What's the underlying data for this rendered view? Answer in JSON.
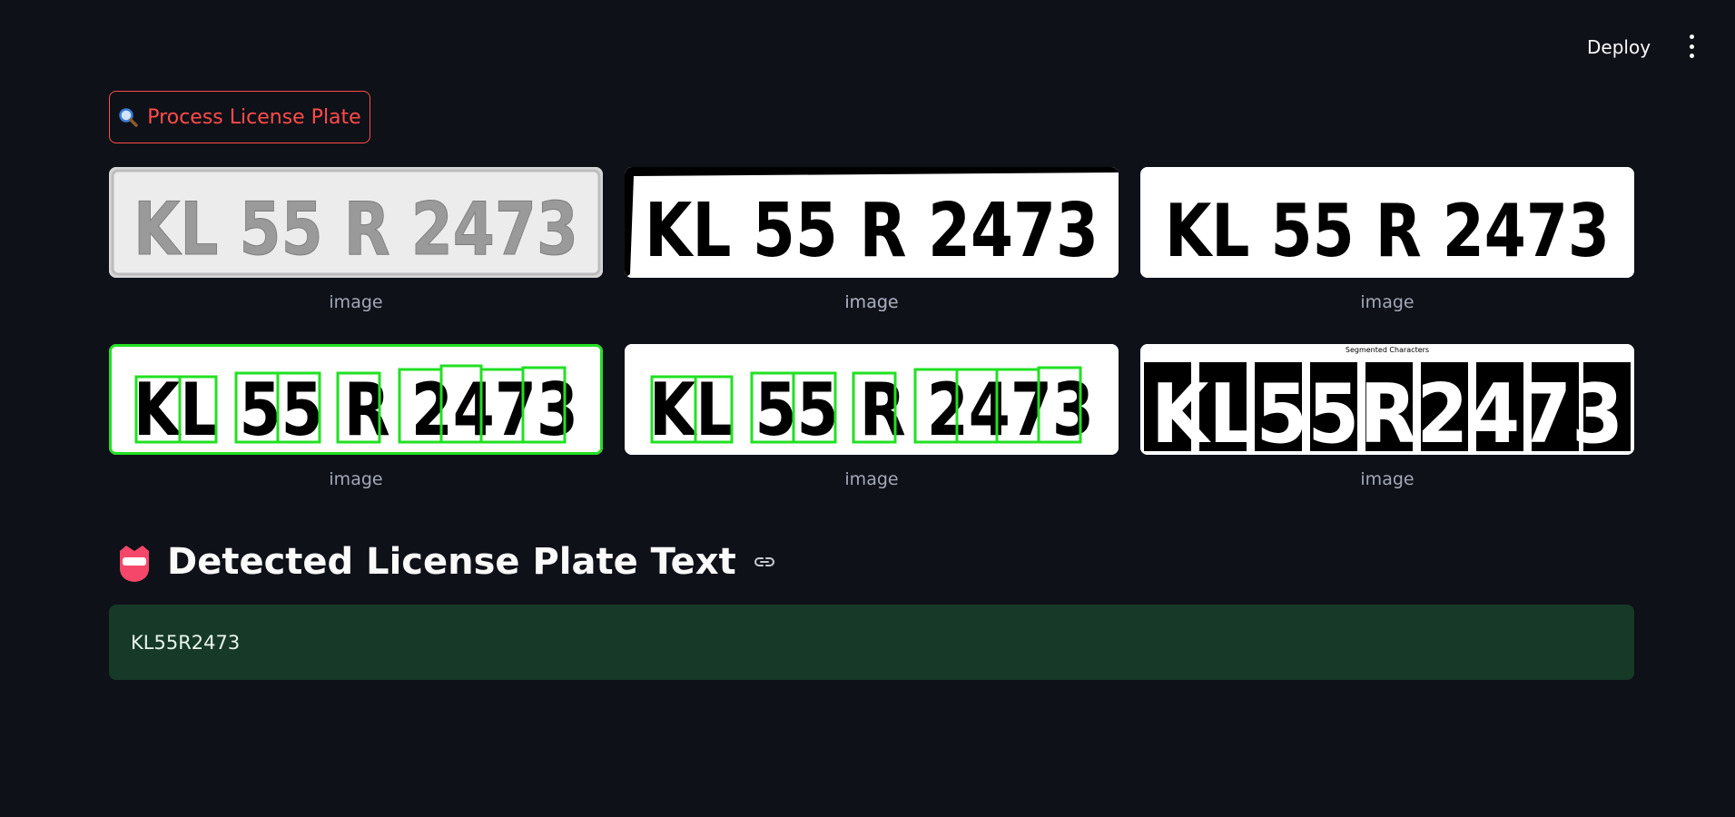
{
  "header": {
    "deploy_label": "Deploy",
    "menu_icon": "more-vertical-icon"
  },
  "actions": {
    "process_label": "Process License Plate",
    "process_icon": "magnifier-icon"
  },
  "images": [
    {
      "caption": "image",
      "plate_text": "KL 55 R 2473",
      "variant": "grayscale"
    },
    {
      "caption": "image",
      "plate_text": "KL 55 R 2473",
      "variant": "binary-threshold"
    },
    {
      "caption": "image",
      "plate_text": "KL 55 R 2473",
      "variant": "binary-cleaned"
    },
    {
      "caption": "image",
      "plate_text": "KL 55 R 2473",
      "variant": "contours-boxes"
    },
    {
      "caption": "image",
      "plate_text": "KL 55 R 2473",
      "variant": "contours-boxes-clean"
    },
    {
      "caption": "image",
      "plate_text": "KL55R2473",
      "variant": "segmented-characters",
      "subtitle": "Segmented Characters"
    }
  ],
  "result": {
    "title": "Detected License Plate Text",
    "title_icon": "name-badge-icon",
    "link_icon": "link-icon",
    "text": "KL55R2473"
  },
  "colors": {
    "background": "#0e1117",
    "accent": "#ff4b4b",
    "success_bg": "#173928",
    "box_green": "#22e022"
  }
}
